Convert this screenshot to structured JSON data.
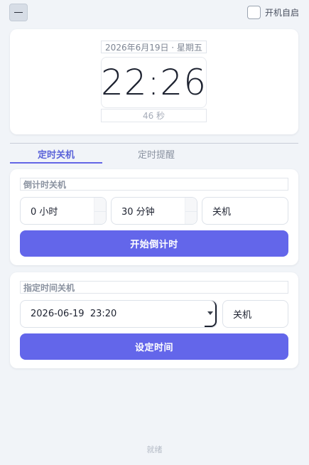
{
  "topbar": {
    "minimize_icon": "minus-icon",
    "autostart_label": "开机自启",
    "autostart_checked": false
  },
  "clock": {
    "date": "2026年6月19日 · 星期五",
    "time": "22:26",
    "seconds": "46 秒"
  },
  "tabs": [
    {
      "label": "定时关机",
      "active": true
    },
    {
      "label": "定时提醒",
      "active": false
    }
  ],
  "countdown": {
    "title": "倒计时关机",
    "hours_value": "0 小时",
    "minutes_value": "30 分钟",
    "action_value": "关机",
    "start_button": "开始倒计时"
  },
  "scheduled": {
    "title": "指定时间关机",
    "datetime_value": "2026-06-19  23:20",
    "action_value": "关机",
    "set_button": "设定时间"
  },
  "status": "就绪",
  "colors": {
    "accent": "#6366ea",
    "background": "#f1f4f8"
  }
}
